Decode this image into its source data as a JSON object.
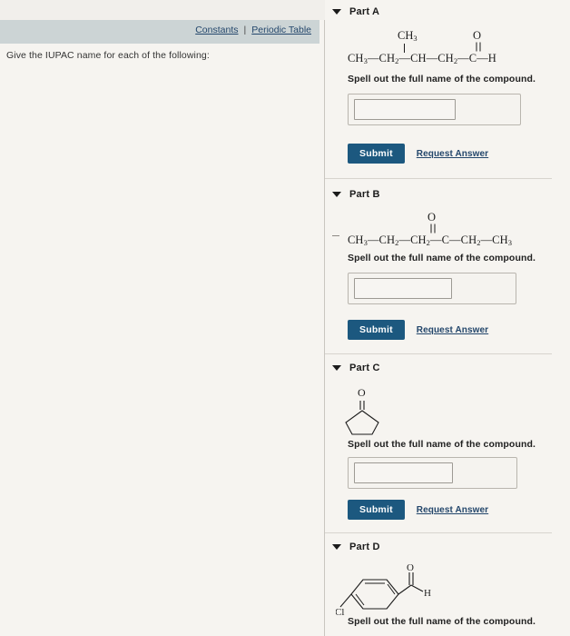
{
  "left_panel": {
    "links": {
      "constants": "Constants",
      "separator": "|",
      "periodic_table": "Periodic Table"
    },
    "prompt": "Give the IUPAC name for each of the following:"
  },
  "common": {
    "instruction": "Spell out the full name of the compound.",
    "submit_label": "Submit",
    "request_answer_label": "Request Answer",
    "answer_value": "",
    "answer_placeholder": ""
  },
  "colors": {
    "submit_button": "#1c587f",
    "link": "#23466b",
    "link_bar_background": "#ccd4d5",
    "page_background": "#f6f4f0",
    "structure_ink": "#1c1c1c"
  },
  "parts": [
    {
      "id": "a",
      "label": "Part A",
      "caret_icon": "triangle-down-icon",
      "structure_type": "text-formula",
      "structure_description": "3-methylpentanal skeletal text formula",
      "formula_main": "CH3—CH2—CH—CH2—C—H",
      "formula_branch": "CH3",
      "formula_carbonyl_oxygen": "O",
      "segments": [
        "CH",
        "3",
        "—CH",
        "2",
        "—CH—CH",
        "2",
        "—C—H"
      ]
    },
    {
      "id": "b",
      "label": "Part B",
      "caret_icon": "triangle-down-icon",
      "structure_type": "text-formula",
      "structure_description": "hexan-3-one skeletal text formula",
      "formula_main": "CH3—CH2—CH2—C—CH2—CH3",
      "formula_carbonyl_oxygen": "O",
      "segments": [
        "CH",
        "3",
        "—CH",
        "2",
        "—CH",
        "2",
        "—C—CH",
        "2",
        "—CH",
        "3"
      ]
    },
    {
      "id": "c",
      "label": "Part C",
      "caret_icon": "triangle-down-icon",
      "structure_type": "ring-drawing",
      "structure_description": "cyclopentanone: five-membered ring with ketone C=O at top",
      "oxygen_label": "O"
    },
    {
      "id": "d",
      "label": "Part D",
      "caret_icon": "triangle-down-icon",
      "structure_type": "ring-drawing",
      "structure_description": "4-chlorobenzaldehyde: benzene ring with Cl substituent and CHO group",
      "oxygen_label": "O",
      "hydrogen_label": "H",
      "chlorine_label": "Cl"
    }
  ]
}
